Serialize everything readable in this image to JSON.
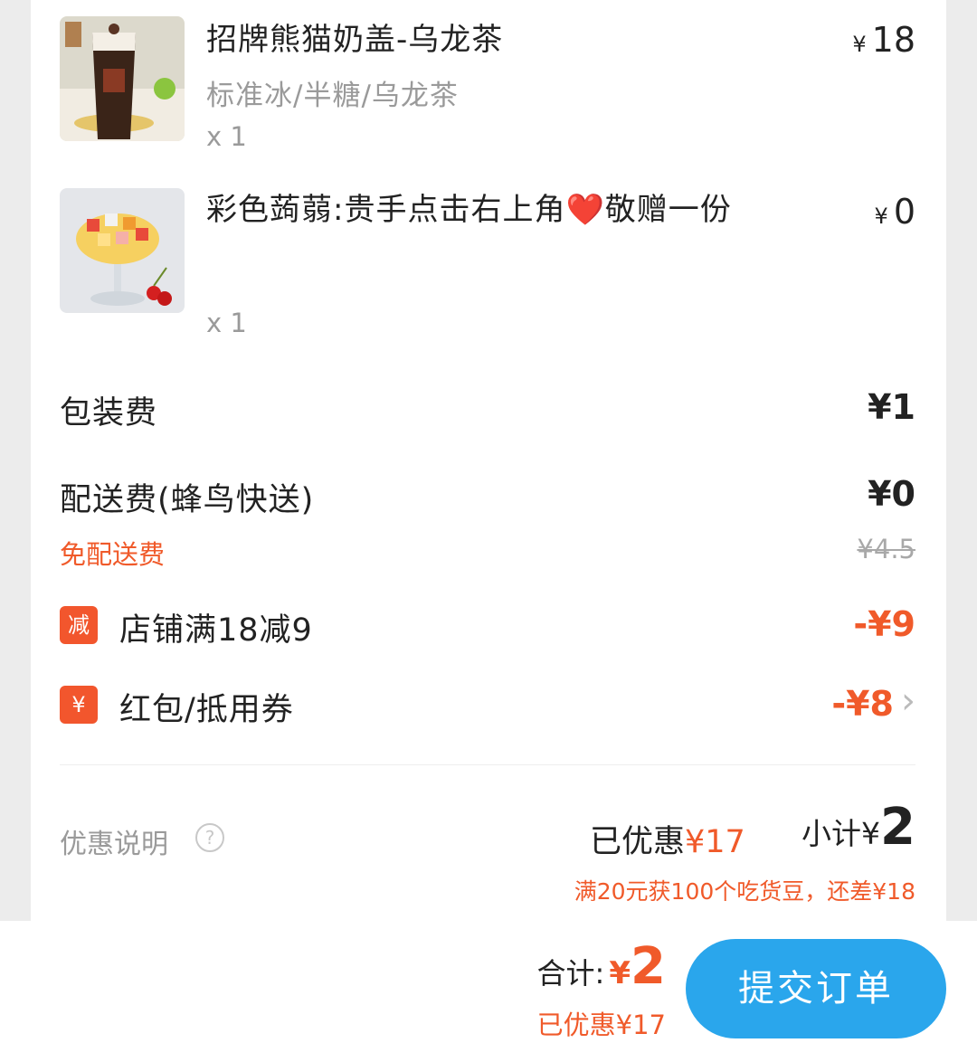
{
  "items": [
    {
      "name": "招牌熊猫奶盖-乌龙茶",
      "spec": "标准冰/半糖/乌龙茶",
      "qty": "x 1",
      "currency": "¥",
      "price": "18"
    },
    {
      "name": "彩色蒟蒻:贵手点击右上角❤️敬赠一份",
      "qty": "x 1",
      "currency": "¥",
      "price": "0"
    }
  ],
  "fees": {
    "packaging_label": "包装费",
    "packaging_value": "¥1",
    "delivery_label": "配送费(蜂鸟快送)",
    "delivery_value": "¥0",
    "free_delivery_label": "免配送费",
    "original_delivery": "¥4.5"
  },
  "promos": [
    {
      "badge": "减",
      "label": "店铺满18减9",
      "value": "-¥9"
    },
    {
      "badge": "¥",
      "label": "红包/抵用券",
      "value": "-¥8",
      "chevron": "›"
    }
  ],
  "summary": {
    "note_label": "优惠说明",
    "help_icon": "?",
    "saved_prefix": "已优惠",
    "saved_amount": "¥17",
    "subtotal_label": "小计¥",
    "subtotal_value": "2",
    "bonus_text": "满20元获100个吃货豆，还差¥18"
  },
  "bottom": {
    "total_label": "合计:",
    "total_currency": "¥",
    "total_value": "2",
    "total_saved": "已优惠¥17",
    "submit_label": "提交订单"
  },
  "colors": {
    "accent": "#f05a2a",
    "button": "#2aa6ec"
  }
}
